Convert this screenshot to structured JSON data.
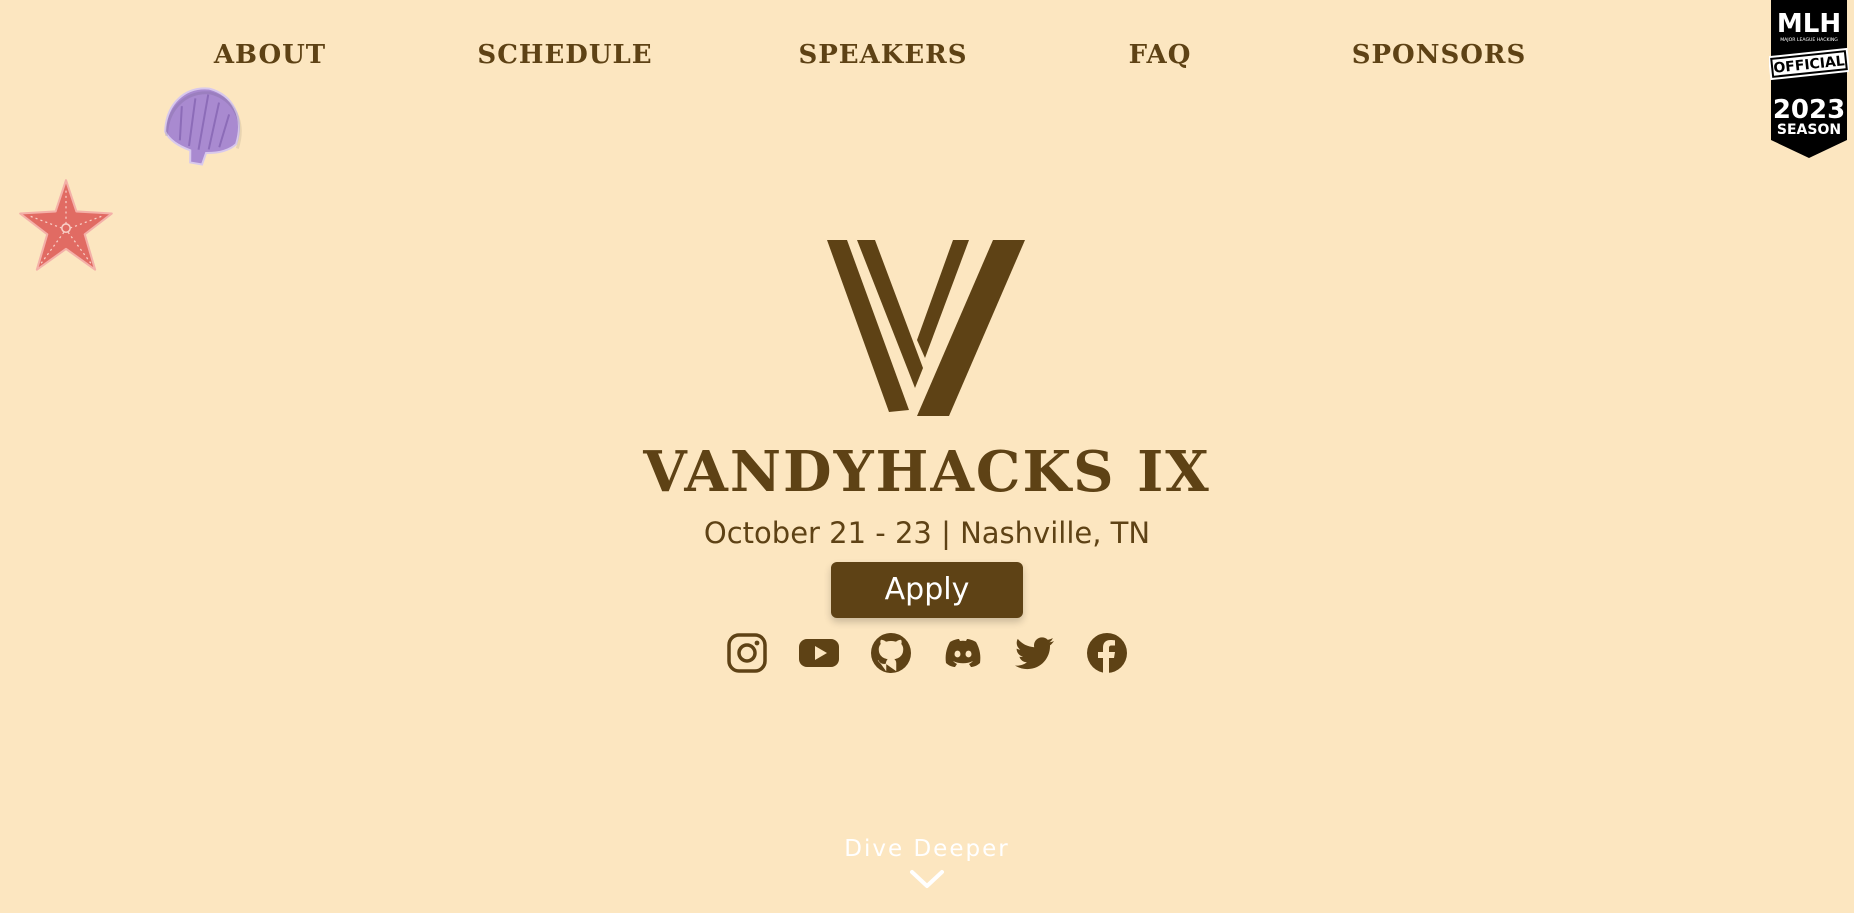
{
  "nav": {
    "items": [
      {
        "label": "ABOUT"
      },
      {
        "label": "SCHEDULE"
      },
      {
        "label": "SPEAKERS"
      },
      {
        "label": "FAQ"
      },
      {
        "label": "SPONSORS"
      }
    ]
  },
  "badge": {
    "brand": "MLH",
    "tagline": "MAJOR LEAGUE HACKING",
    "official": "OFFICIAL",
    "year": "2023",
    "season": "SEASON"
  },
  "hero": {
    "title": "VANDYHACKS IX",
    "subtitle": "October 21 - 23 | Nashville, TN",
    "apply_label": "Apply"
  },
  "socials": [
    {
      "icon": "instagram-icon"
    },
    {
      "icon": "youtube-icon"
    },
    {
      "icon": "github-icon"
    },
    {
      "icon": "discord-icon"
    },
    {
      "icon": "twitter-icon"
    },
    {
      "icon": "facebook-icon"
    }
  ],
  "footer": {
    "dive_label": "Dive Deeper"
  },
  "colors": {
    "background": "#fce6c0",
    "brand_brown": "#5e4215",
    "shell_purple": "#a98ad0",
    "starfish_red": "#e16b63",
    "badge_black": "#000000"
  }
}
